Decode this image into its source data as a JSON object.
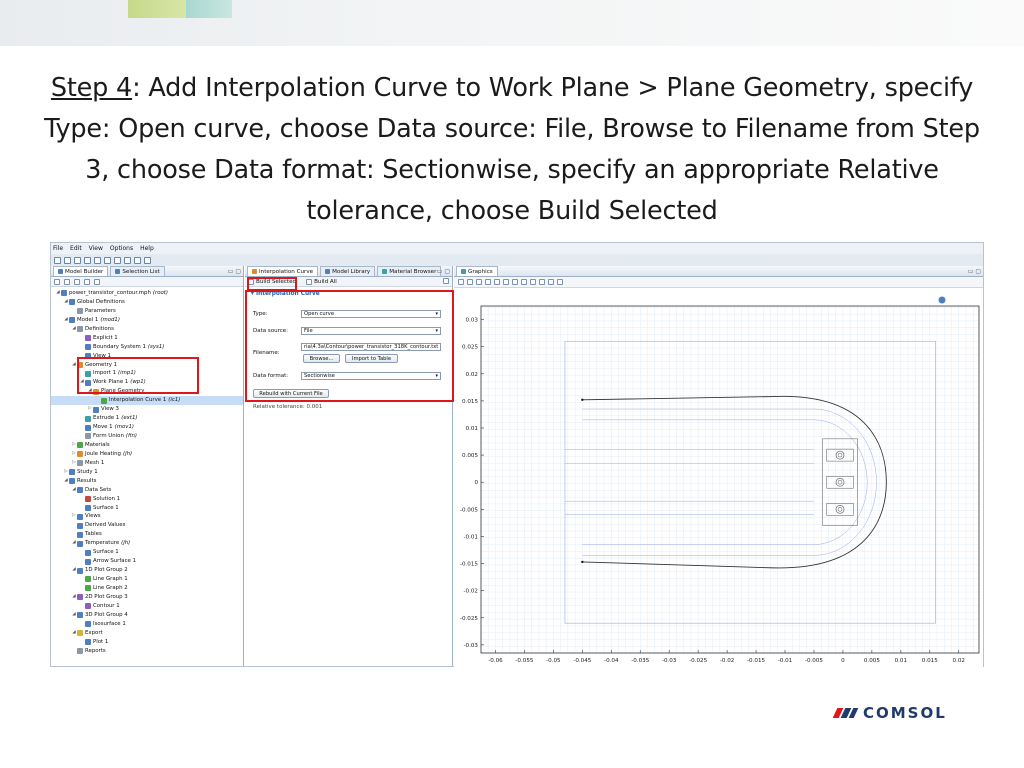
{
  "slide": {
    "step_label": "Step 4",
    "title_rest": ": Add Interpolation Curve to Work Plane > Plane Geometry, specify Type: Open curve, choose Data source: File, Browse to Filename from Step 3, choose Data format: Sectionwise, specify an appropriate Relative tolerance, choose Build Selected"
  },
  "app": {
    "menu": [
      "File",
      "Edit",
      "View",
      "Options",
      "Help"
    ],
    "left_tabs": [
      "Model Builder",
      "Selection List"
    ],
    "mid_tabs": [
      "Interpolation Curve",
      "Model Library",
      "Material Browser"
    ],
    "right_tabs": [
      "Graphics"
    ],
    "tree": [
      {
        "label": "power_transistor_contour.mph",
        "tag": "(root)",
        "indent": 0,
        "icon": "ic-blue",
        "arrow": "◢"
      },
      {
        "label": "Global Definitions",
        "tag": "",
        "indent": 1,
        "icon": "ic-blue",
        "arrow": "◢"
      },
      {
        "label": "Parameters",
        "tag": "",
        "indent": 2,
        "icon": "ic-gray",
        "arrow": ""
      },
      {
        "label": "Model 1",
        "tag": "(mod1)",
        "indent": 1,
        "icon": "ic-blue",
        "arrow": "◢"
      },
      {
        "label": "Definitions",
        "tag": "",
        "indent": 2,
        "icon": "ic-gray",
        "arrow": "◢"
      },
      {
        "label": "Explicit 1",
        "tag": "",
        "indent": 3,
        "icon": "ic-purple",
        "arrow": ""
      },
      {
        "label": "Boundary System 1",
        "tag": "(sys1)",
        "indent": 3,
        "icon": "ic-blue",
        "arrow": ""
      },
      {
        "label": "View 1",
        "tag": "",
        "indent": 3,
        "icon": "ic-blue",
        "arrow": ""
      },
      {
        "label": "Geometry 1",
        "tag": "",
        "indent": 2,
        "icon": "ic-orange",
        "arrow": "◢"
      },
      {
        "label": "Import 1",
        "tag": "(imp1)",
        "indent": 3,
        "icon": "ic-teal",
        "arrow": ""
      },
      {
        "label": "Work Plane 1",
        "tag": "(wp1)",
        "indent": 3,
        "icon": "ic-blue",
        "arrow": "◢"
      },
      {
        "label": "Plane Geometry",
        "tag": "",
        "indent": 4,
        "icon": "ic-orange",
        "arrow": "◢"
      },
      {
        "label": "Interpolation Curve 1",
        "tag": "(ic1)",
        "indent": 5,
        "icon": "ic-green",
        "arrow": "",
        "selected": true
      },
      {
        "label": "View 3",
        "tag": "",
        "indent": 4,
        "icon": "ic-blue",
        "arrow": "▷"
      },
      {
        "label": "Extrude 1",
        "tag": "(ext1)",
        "indent": 3,
        "icon": "ic-teal",
        "arrow": ""
      },
      {
        "label": "Move 1",
        "tag": "(mov1)",
        "indent": 3,
        "icon": "ic-blue",
        "arrow": ""
      },
      {
        "label": "Form Union",
        "tag": "(fin)",
        "indent": 3,
        "icon": "ic-gray",
        "arrow": ""
      },
      {
        "label": "Materials",
        "tag": "",
        "indent": 2,
        "icon": "ic-green",
        "arrow": "▷"
      },
      {
        "label": "Joule Heating",
        "tag": "(jh)",
        "indent": 2,
        "icon": "ic-orange",
        "arrow": "▷"
      },
      {
        "label": "Mesh 1",
        "tag": "",
        "indent": 2,
        "icon": "ic-gray",
        "arrow": "▷"
      },
      {
        "label": "Study 1",
        "tag": "",
        "indent": 1,
        "icon": "ic-blue",
        "arrow": "▷"
      },
      {
        "label": "Results",
        "tag": "",
        "indent": 1,
        "icon": "ic-blue",
        "arrow": "◢"
      },
      {
        "label": "Data Sets",
        "tag": "",
        "indent": 2,
        "icon": "ic-blue",
        "arrow": "◢"
      },
      {
        "label": "Solution 1",
        "tag": "",
        "indent": 3,
        "icon": "ic-red",
        "arrow": ""
      },
      {
        "label": "Surface 1",
        "tag": "",
        "indent": 3,
        "icon": "ic-blue",
        "arrow": ""
      },
      {
        "label": "Views",
        "tag": "",
        "indent": 2,
        "icon": "ic-blue",
        "arrow": "▷"
      },
      {
        "label": "Derived Values",
        "tag": "",
        "indent": 2,
        "icon": "ic-blue",
        "arrow": ""
      },
      {
        "label": "Tables",
        "tag": "",
        "indent": 2,
        "icon": "ic-blue",
        "arrow": ""
      },
      {
        "label": "Temperature",
        "tag": "(jh)",
        "indent": 2,
        "icon": "ic-blue",
        "arrow": "◢"
      },
      {
        "label": "Surface 1",
        "tag": "",
        "indent": 3,
        "icon": "ic-blue",
        "arrow": ""
      },
      {
        "label": "Arrow Surface 1",
        "tag": "",
        "indent": 3,
        "icon": "ic-blue",
        "arrow": ""
      },
      {
        "label": "1D Plot Group 2",
        "tag": "",
        "indent": 2,
        "icon": "ic-blue",
        "arrow": "◢"
      },
      {
        "label": "Line Graph 1",
        "tag": "",
        "indent": 3,
        "icon": "ic-green",
        "arrow": ""
      },
      {
        "label": "Line Graph 2",
        "tag": "",
        "indent": 3,
        "icon": "ic-green",
        "arrow": ""
      },
      {
        "label": "2D Plot Group 3",
        "tag": "",
        "indent": 2,
        "icon": "ic-purple",
        "arrow": "◢"
      },
      {
        "label": "Contour 1",
        "tag": "",
        "indent": 3,
        "icon": "ic-purple",
        "arrow": ""
      },
      {
        "label": "3D Plot Group 4",
        "tag": "",
        "indent": 2,
        "icon": "ic-blue",
        "arrow": "◢"
      },
      {
        "label": "Isosurface 1",
        "tag": "",
        "indent": 3,
        "icon": "ic-blue",
        "arrow": ""
      },
      {
        "label": "Export",
        "tag": "",
        "indent": 2,
        "icon": "ic-yellow",
        "arrow": "◢"
      },
      {
        "label": "Plot 1",
        "tag": "",
        "indent": 3,
        "icon": "ic-blue",
        "arrow": ""
      },
      {
        "label": "Reports",
        "tag": "",
        "indent": 2,
        "icon": "ic-gray",
        "arrow": ""
      }
    ],
    "settings": {
      "build_selected": "Build Selected",
      "build_all": "Build All",
      "section": "Interpolation Curve",
      "type_label": "Type:",
      "type_value": "Open curve",
      "source_label": "Data source:",
      "source_value": "File",
      "filename_label": "Filename:",
      "filename_value": "ria\\4.3a\\Contour\\power_transistor_318K_contour.txt",
      "browse": "Browse...",
      "import_table": "Import to Table",
      "format_label": "Data format:",
      "format_value": "Sectionwise",
      "rebuild": "Rebuild with Current File",
      "rel_tol": "Relative tolerance:   0.001"
    },
    "graphics": {
      "y_ticks": [
        "0.03",
        "0.025",
        "0.02",
        "0.015",
        "0.01",
        "0.005",
        "0",
        "-0.005",
        "-0.01",
        "-0.015",
        "-0.02",
        "-0.025",
        "-0.03"
      ],
      "x_ticks": [
        "-0.06",
        "-0.055",
        "-0.05",
        "-0.045",
        "-0.04",
        "-0.035",
        "-0.03",
        "-0.025",
        "-0.02",
        "-0.015",
        "-0.01",
        "-0.005",
        "0",
        "0.005",
        "0.01",
        "0.015",
        "0.02"
      ]
    }
  },
  "logo": {
    "text": "COMSOL",
    "color": "#1f3a6b"
  }
}
